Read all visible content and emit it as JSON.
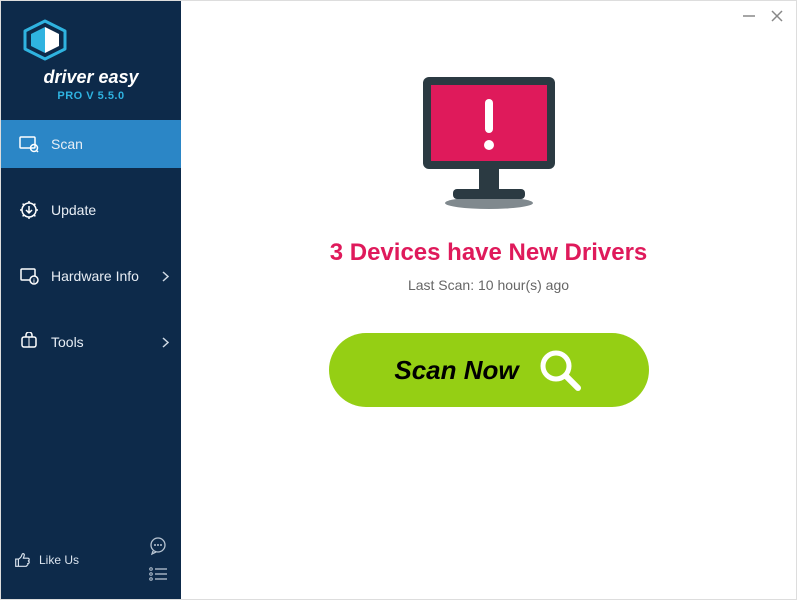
{
  "brand": {
    "name": "driver easy",
    "version": "PRO V 5.5.0"
  },
  "nav": {
    "scan": {
      "label": "Scan"
    },
    "update": {
      "label": "Update"
    },
    "hardware": {
      "label": "Hardware Info"
    },
    "tools": {
      "label": "Tools"
    }
  },
  "footer": {
    "like_us": "Like Us"
  },
  "main": {
    "headline": "3 Devices have New Drivers",
    "last_scan": "Last Scan: 10 hour(s) ago",
    "scan_button": "Scan Now"
  },
  "colors": {
    "accent_pink": "#df1a5b",
    "scan_green": "#95cf14",
    "sidebar": "#0d2a4a",
    "active": "#2b86c6"
  }
}
